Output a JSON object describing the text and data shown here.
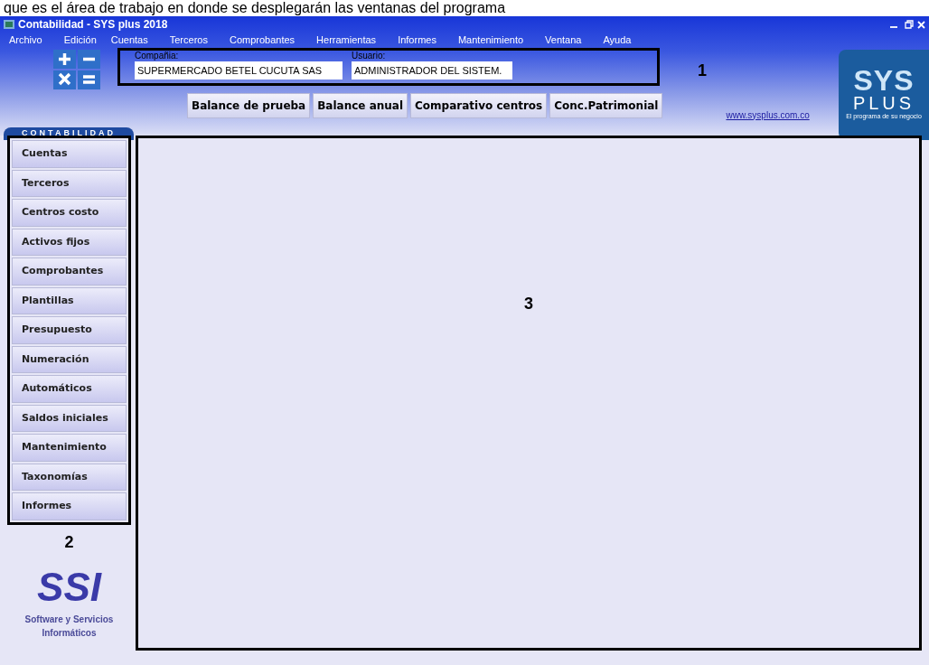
{
  "caption": "que es el área de trabajo en donde se desplegarán las ventanas del programa",
  "window": {
    "title": "Contabilidad - SYS plus 2018"
  },
  "menu": [
    "Archivo",
    "Edición",
    "Cuentas",
    "Terceros",
    "Comprobantes",
    "Herramientas",
    "Informes",
    "Mantenimiento",
    "Ventana",
    "Ayuda"
  ],
  "company": {
    "label": "Compañia:",
    "value": "SUPERMERCADO BETEL CUCUTA SAS"
  },
  "user": {
    "label": "Usuario:",
    "value": "ADMINISTRADOR DEL SISTEM."
  },
  "markers": [
    "1",
    "2",
    "3"
  ],
  "toolbar": [
    "Balance de prueba",
    "Balance anual",
    "Comparativo centros",
    "Conc.Patrimonial"
  ],
  "link": "www.sysplus.com.co",
  "brand": {
    "name": "SYS",
    "sub": "PLUS",
    "tagline": "El programa de su negocio"
  },
  "module": "CONTABILIDAD",
  "sidebar": {
    "items": [
      "Cuentas",
      "Terceros",
      "Centros costo",
      "Activos fijos",
      "Comprobantes",
      "Plantillas",
      "Presupuesto",
      "Numeración",
      "Automáticos",
      "Saldos iniciales",
      "Mantenimiento",
      "Taxonomías",
      "Informes"
    ]
  },
  "vendor": {
    "logo": "SSI",
    "line_1": "Software y Servicios",
    "line_2": "Informáticos"
  }
}
